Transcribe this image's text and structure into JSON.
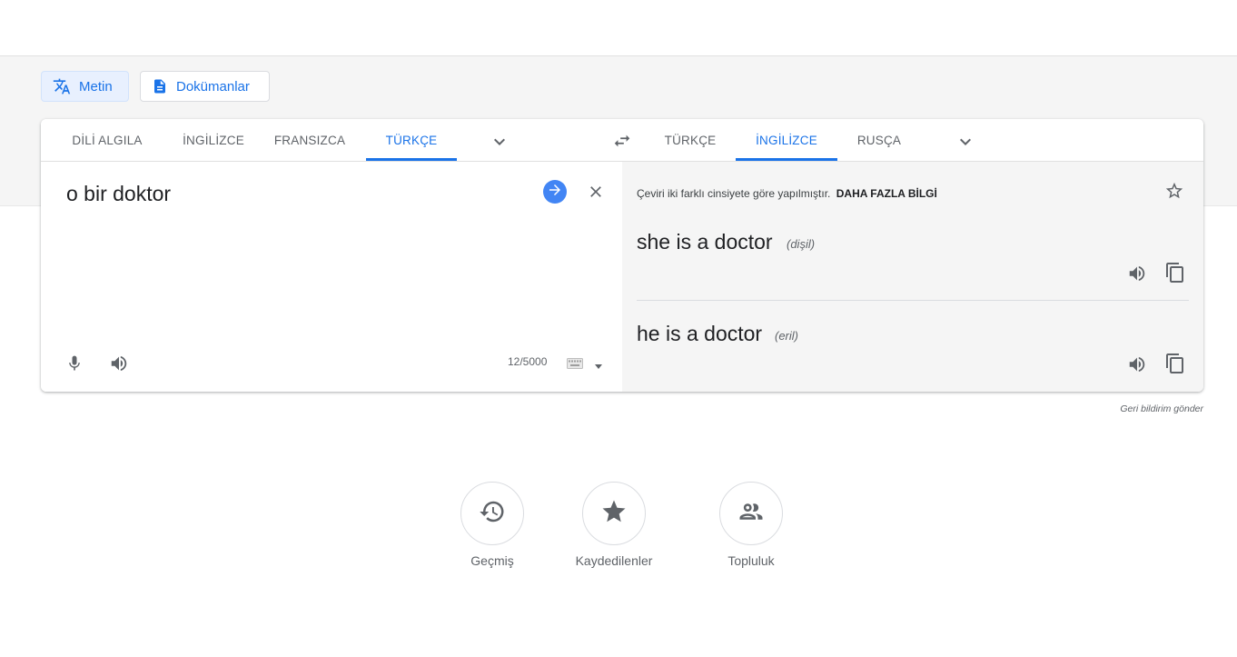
{
  "modes": [
    {
      "label": "Metin",
      "icon": "translate-icon",
      "active": true
    },
    {
      "label": "Dokümanlar",
      "icon": "document-icon",
      "active": false
    }
  ],
  "source_langs": [
    "DİLİ ALGILA",
    "İNGİLİZCE",
    "FRANSIZCA",
    "TÜRKÇE"
  ],
  "target_langs": [
    "TÜRKÇE",
    "İNGİLİZCE",
    "RUSÇA"
  ],
  "source": {
    "text": "o bir doktor",
    "char_count": "12/5000"
  },
  "target": {
    "gender_note": "Çeviri iki farklı cinsiyete göre yapılmıştır.",
    "learn_more": "DAHA FAZLA BİLGİ",
    "translations": [
      {
        "text": "she is a doctor",
        "gender": "(dişil)"
      },
      {
        "text": "he is a doctor",
        "gender": "(eril)"
      }
    ]
  },
  "feedback": "Geri bildirim gönder",
  "shortcuts": [
    {
      "label": "Geçmiş",
      "icon": "history-icon"
    },
    {
      "label": "Kaydedilenler",
      "icon": "star-icon"
    },
    {
      "label": "Topluluk",
      "icon": "community-icon"
    }
  ],
  "colors": {
    "accent": "#1a73e8",
    "go_button": "#4285f4",
    "target_bg": "#f5f5f5"
  }
}
